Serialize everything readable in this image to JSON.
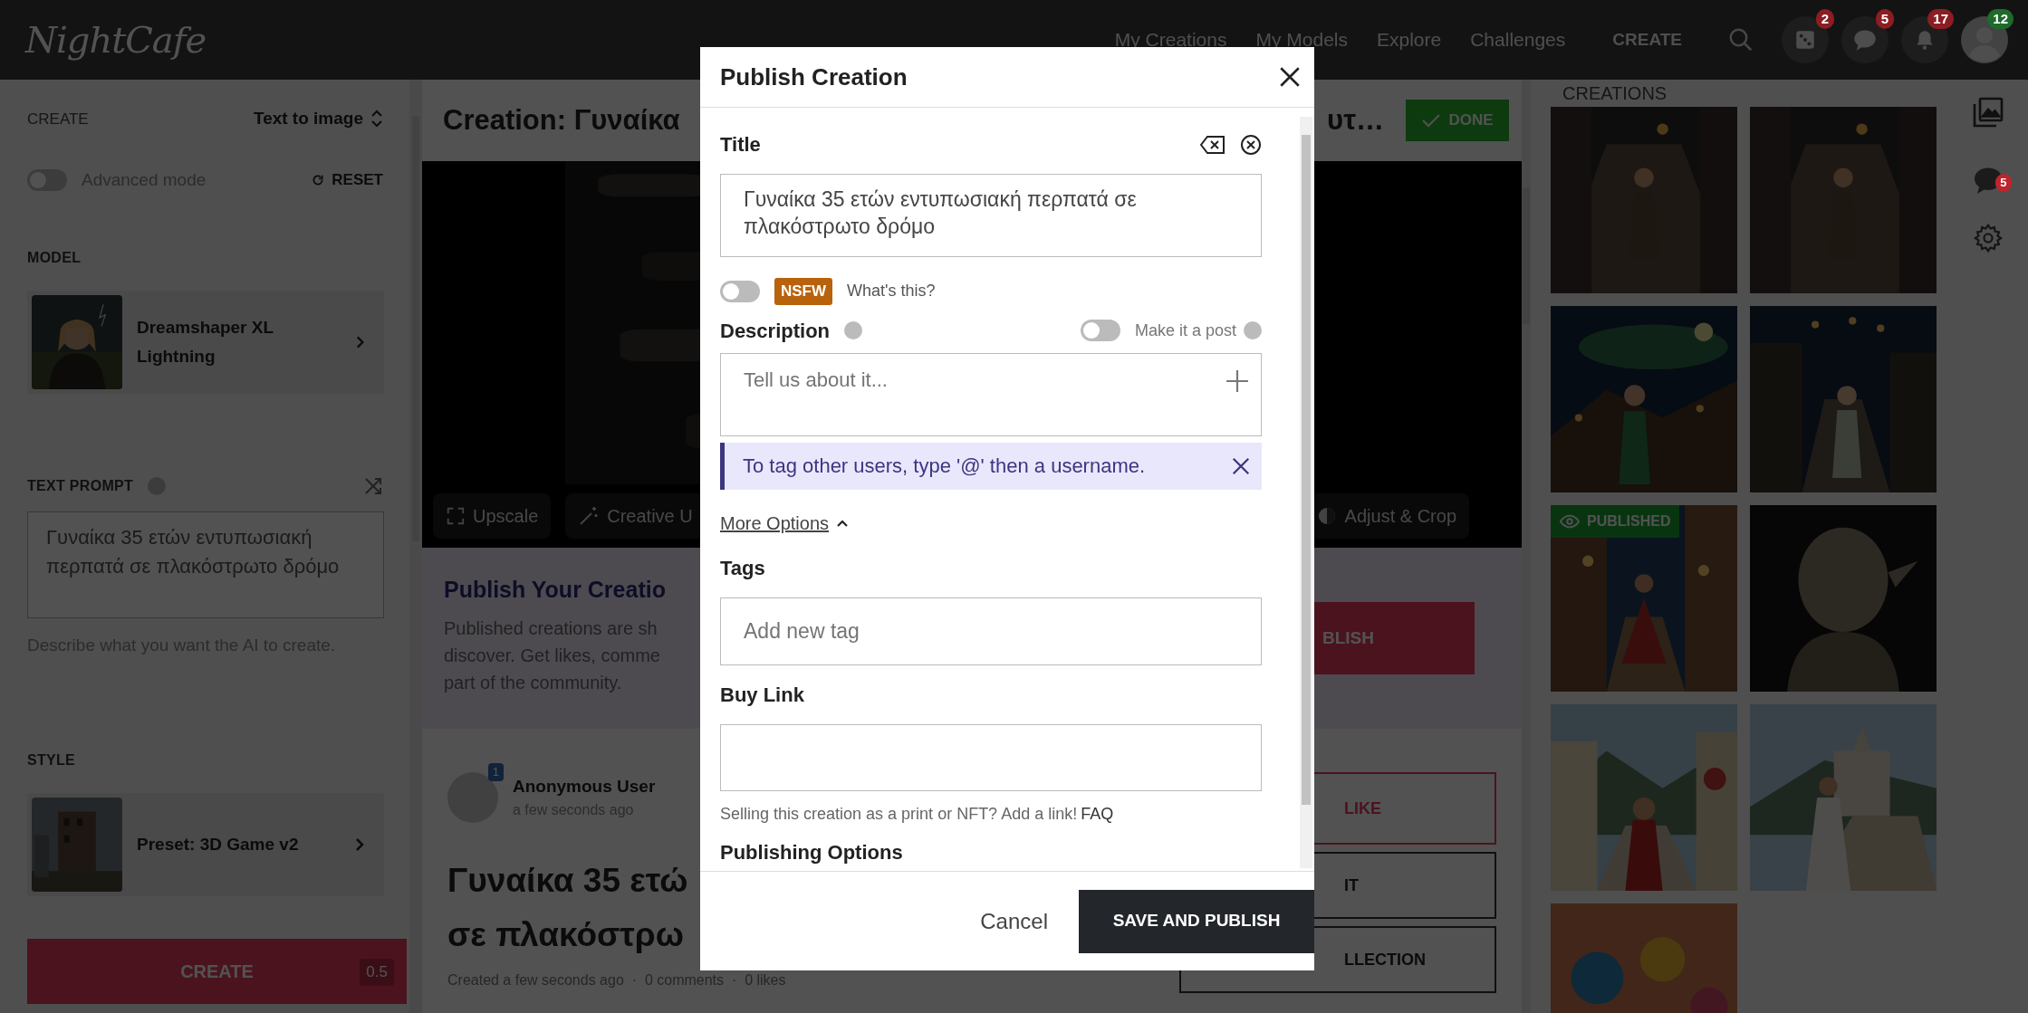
{
  "navbar": {
    "logo": "NightCafe",
    "links": [
      {
        "label": "My Creations",
        "kind": "link"
      },
      {
        "label": "My Models",
        "kind": "link"
      },
      {
        "label": "Explore",
        "kind": "link"
      },
      {
        "label": "Challenges",
        "kind": "link"
      },
      {
        "label": "CREATE",
        "kind": "cta"
      }
    ],
    "icons": [
      {
        "kind": "dice",
        "badge": "2",
        "color": "#8c1d22"
      },
      {
        "kind": "chat",
        "badge": "5",
        "color": "#8c1d22"
      },
      {
        "kind": "bell",
        "badge": "17",
        "color": "#8c1d22"
      },
      {
        "kind": "avatar",
        "badge": "12",
        "color": "#1d6a2a"
      }
    ]
  },
  "left_panel": {
    "heading": "CREATE",
    "mode": "Text to image",
    "advanced_mode": {
      "label": "Advanced mode",
      "on": false
    },
    "reset": "RESET",
    "model": {
      "heading": "MODEL",
      "name": "Dreamshaper XL Lightning",
      "kind": "picture"
    },
    "text_prompt": {
      "heading": "TEXT PROMPT",
      "value": "Γυναίκα 35 ετών εντυπωσιακή περπατά σε πλακόστρωτο δρόμο",
      "hint": "Describe what you want the AI to create."
    },
    "style": {
      "heading": "STYLE",
      "name": "Preset: 3D Game v2",
      "kind": "picture"
    },
    "create_button": {
      "label": "CREATE",
      "cost": "0.5"
    }
  },
  "main": {
    "title_start": "Creation: Γυναίκα",
    "title_end": "υτ…",
    "done": "DONE",
    "tools": [
      {
        "label": "Upscale",
        "kind": "upscale"
      },
      {
        "label": "Creative U",
        "kind": "wand"
      },
      {
        "label": "Adjust & Crop",
        "kind": "adjust"
      }
    ],
    "publish_box": {
      "heading": "Publish Your Creatio",
      "lines": [
        "Published creations are sh",
        "discover. Get likes, comme",
        "part of the community."
      ],
      "button": "BLISH"
    },
    "author": {
      "name": "Anonymous User",
      "time": "a few seconds ago",
      "badge": "1"
    },
    "big_title_lines": [
      "Γυναίκα 35 ετώ",
      "σε πλακόστρω"
    ],
    "meta": "Created a few seconds ago  ·  0 comments  ·  0 likes",
    "actions": [
      {
        "label": "LIKE",
        "kind": "like"
      },
      {
        "label": "IT",
        "kind": "plain"
      },
      {
        "label": "LLECTION",
        "kind": "plain"
      }
    ]
  },
  "creations": {
    "heading": "CREATIONS",
    "published_label": "PUBLISHED",
    "items": [
      {
        "kind": "picture",
        "published": false
      },
      {
        "kind": "picture",
        "published": false
      },
      {
        "kind": "picture",
        "published": false
      },
      {
        "kind": "picture",
        "published": false
      },
      {
        "kind": "picture",
        "published": true
      },
      {
        "kind": "picture",
        "published": false
      },
      {
        "kind": "picture",
        "published": false
      },
      {
        "kind": "picture",
        "published": false
      },
      {
        "kind": "picture",
        "published": false
      }
    ]
  },
  "rail": {
    "chat_badge": "5"
  },
  "modal": {
    "title": "Publish Creation",
    "title_label": "Title",
    "title_value": "Γυναίκα 35 ετών εντυπωσιακή περπατά σε πλακόστρωτο δρόμο",
    "nsfw": {
      "on": false,
      "badge": "NSFW",
      "link": "What's this?"
    },
    "description": {
      "label": "Description",
      "post_toggle": {
        "label": "Make it a post",
        "on": false
      },
      "placeholder": "Tell us about it...",
      "tip": "To tag other users, type '@' then a username."
    },
    "more_options": {
      "label": "More Options",
      "expanded": true
    },
    "tags": {
      "label": "Tags",
      "placeholder": "Add new tag"
    },
    "buy_link": {
      "label": "Buy Link",
      "help": "Selling this creation as a print or NFT? Add a link!",
      "help_link": "FAQ"
    },
    "publishing_options": "Publishing Options",
    "cancel": "Cancel",
    "submit": "SAVE AND PUBLISH"
  }
}
